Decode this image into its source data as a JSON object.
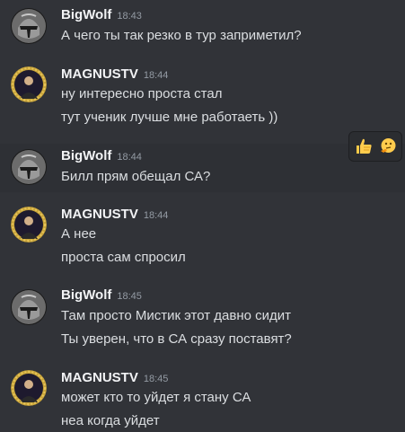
{
  "messages": [
    {
      "author": "BigWolf",
      "time": "18:43",
      "avatar": "helmet-avatar",
      "lines": [
        "А чего ты так резко в тур заприметил?"
      ]
    },
    {
      "author": "MAGNUSTV",
      "time": "18:44",
      "avatar": "portrait-avatar",
      "lines": [
        "ну интересно проста стал",
        "тут ученик лучше мне работаеть ))"
      ]
    },
    {
      "author": "BigWolf",
      "time": "18:44",
      "avatar": "helmet-avatar",
      "lines": [
        "Билл прям обещал СА?"
      ]
    },
    {
      "author": "MAGNUSTV",
      "time": "18:44",
      "avatar": "portrait-avatar",
      "lines": [
        "А нее",
        "проста сам спросил"
      ]
    },
    {
      "author": "BigWolf",
      "time": "18:45",
      "avatar": "helmet-avatar",
      "lines": [
        "Там просто Мистик этот давно сидит",
        "Ты уверен, что в СА сразу поставят?"
      ]
    },
    {
      "author": "MAGNUSTV",
      "time": "18:45",
      "avatar": "portrait-avatar",
      "lines": [
        "может кто то уйдет я стану СА",
        "неа когда уйдет"
      ]
    }
  ],
  "hover_toolbar": {
    "buttons": [
      "thumbs-up-icon",
      "thinking-face-icon"
    ]
  },
  "colors": {
    "background": "#313338",
    "hover_background": "#2e3035",
    "username": "#f2f3f5",
    "text": "#dbdee1",
    "timestamp": "#949ba4"
  }
}
